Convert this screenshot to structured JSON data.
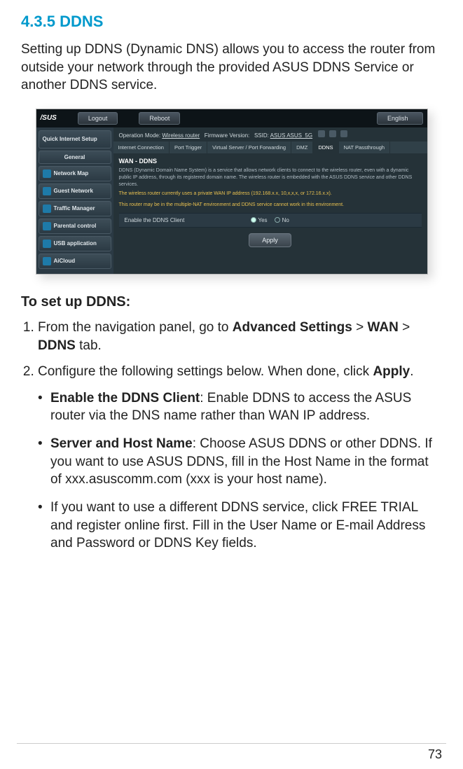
{
  "section": {
    "number": "4.3.5",
    "title": "DDNS"
  },
  "intro": "Setting up DDNS (Dynamic DNS) allows you to access the router from outside your network through the provided ASUS DDNS Service or another DDNS service.",
  "screenshot": {
    "logo": "/SUS",
    "buttons": {
      "logout": "Logout",
      "reboot": "Reboot",
      "lang": "English"
    },
    "status_line": {
      "op_mode_label": "Operation Mode:",
      "op_mode_value": "Wireless router",
      "fw_label": "Firmware Version:",
      "ssid_label": "SSID:",
      "ssid_value": "ASUS  ASUS_5G"
    },
    "sidebar": {
      "qis": "Quick Internet Setup",
      "items": [
        "General",
        "Network Map",
        "Guest Network",
        "Traffic Manager",
        "Parental control",
        "USB application",
        "AiCloud"
      ]
    },
    "tabs": [
      "Internet Connection",
      "Port Trigger",
      "Virtual Server / Port Forwarding",
      "DMZ",
      "DDNS",
      "NAT Passthrough"
    ],
    "selected_tab_index": 4,
    "panel": {
      "heading": "WAN - DDNS",
      "desc": "DDNS (Dynamic Domain Name System) is a service that allows network clients to connect to the wireless router, even with a dynamic public IP address, through its registered domain name. The wireless router is embedded with the ASUS DDNS service and other DDNS services.",
      "warn1": "The wireless router currently uses a private WAN IP address (192.168.x.x, 10,x,x,x, or 172.16.x.x).",
      "warn2": "This router may be in the multiple-NAT environment and DDNS service cannot work in this environment.",
      "row_label": "Enable the DDNS Client",
      "yes": "Yes",
      "no": "No",
      "apply": "Apply"
    }
  },
  "setup_heading": "To set up DDNS:",
  "steps": {
    "s1_a": "From the navigation panel, go to ",
    "s1_b": "Advanced Settings",
    "s1_c": " > ",
    "s1_d": "WAN",
    "s1_e": " > ",
    "s1_f": "DDNS",
    "s1_g": " tab.",
    "s2_a": "Configure the following settings below. When done, click ",
    "s2_b": "Apply",
    "s2_c": "."
  },
  "bullets": {
    "b1_a": "Enable the DDNS Client",
    "b1_b": ": Enable DDNS to access the ASUS router via the DNS name rather than WAN IP address.",
    "b2_a": "Server and Host Name",
    "b2_b": ": Choose ASUS DDNS or other DDNS. If you want to use ASUS DDNS, fill in the Host Name in the format of xxx.asuscomm.com (xxx is your host name).",
    "b3": "If you want to use a different DDNS service, click FREE TRIAL and register online first. Fill in the User Name or E-mail Address and Password or DDNS Key fields."
  },
  "page_number": "73"
}
